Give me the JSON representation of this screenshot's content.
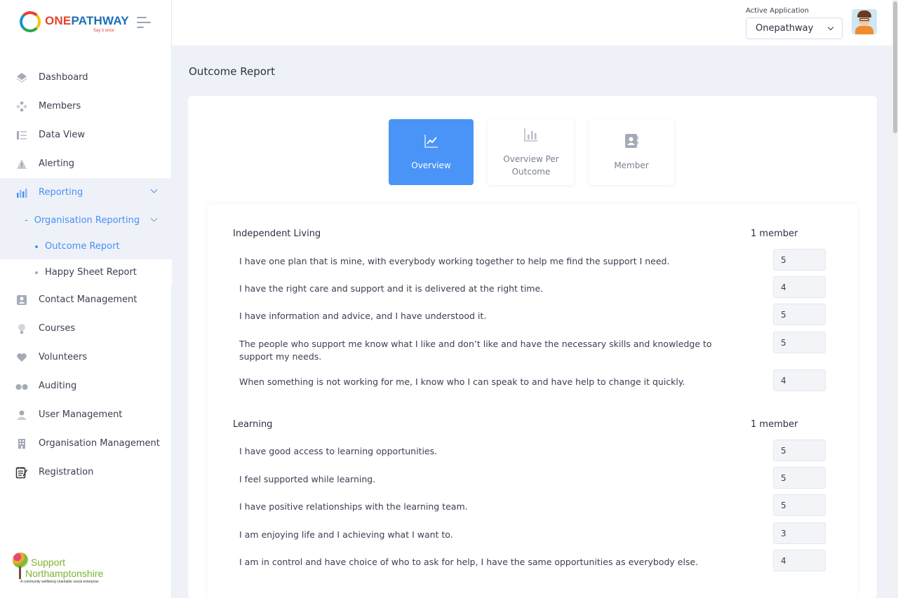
{
  "brand": {
    "logo_one": "ONE",
    "logo_pathway": "PATHWAY",
    "tagline": "Say it once",
    "footer_logo_line1": "Support",
    "footer_logo_line2": "Northamptonshire",
    "footer_logo_line3": "A community wellbeing charitable social enterprise"
  },
  "sidebar": {
    "items": [
      {
        "label": "Dashboard",
        "icon": "layers-icon"
      },
      {
        "label": "Members",
        "icon": "members-icon"
      },
      {
        "label": "Data View",
        "icon": "list-icon"
      },
      {
        "label": "Alerting",
        "icon": "warning-icon"
      },
      {
        "label": "Reporting",
        "icon": "bar-chart-icon"
      },
      {
        "label": "Contact Management",
        "icon": "contact-icon"
      },
      {
        "label": "Courses",
        "icon": "lightbulb-icon"
      },
      {
        "label": "Volunteers",
        "icon": "heart-icon"
      },
      {
        "label": "Auditing",
        "icon": "binoculars-icon"
      },
      {
        "label": "User Management",
        "icon": "user-icon"
      },
      {
        "label": "Organisation Management",
        "icon": "building-icon"
      },
      {
        "label": "Registration",
        "icon": "notepad-icon"
      }
    ],
    "sub_dash": "-",
    "org_reporting": "Organisation Reporting",
    "outcome_report": "Outcome Report",
    "happy_sheet": "Happy Sheet Report"
  },
  "header": {
    "active_label": "Active Application",
    "app_selected": "Onepathway"
  },
  "page": {
    "title": "Outcome Report"
  },
  "tabs": [
    {
      "label": "Overview",
      "icon": "line-chart-icon",
      "active": true
    },
    {
      "label": "Overview Per Outcome",
      "icon": "bar-chart-icon",
      "active": false
    },
    {
      "label": "Member",
      "icon": "contact-book-icon",
      "active": false
    }
  ],
  "sections": [
    {
      "title": "Independent Living",
      "count": "1 member",
      "questions": [
        {
          "text": "I have one plan that is mine, with everybody working together to help me find the support I need.",
          "score": "5"
        },
        {
          "text": "I have the right care and support and it is delivered at the right time.",
          "score": "4"
        },
        {
          "text": "I have information and advice, and I have understood it.",
          "score": "5"
        },
        {
          "text": "The people who support me know what I like and don’t like and have the necessary skills and knowledge to support my needs.",
          "score": "5"
        },
        {
          "text": "When something is not working for me, I know who I can speak to and have help to change it quickly.",
          "score": "4"
        }
      ]
    },
    {
      "title": "Learning",
      "count": "1 member",
      "questions": [
        {
          "text": "I have good access to learning opportunities.",
          "score": "5"
        },
        {
          "text": "I feel supported while learning.",
          "score": "5"
        },
        {
          "text": "I have positive relationships with the learning team.",
          "score": "5"
        },
        {
          "text": "I am enjoying life and I achieving what I want to.",
          "score": "3"
        },
        {
          "text": "I am in control and have choice of who to ask for help, I have the same opportunities as everybody else.",
          "score": "4"
        }
      ]
    }
  ],
  "colors": {
    "accent": "#4a94f7",
    "active_text": "#4a8ef5",
    "page_bg": "#eef2f8"
  }
}
